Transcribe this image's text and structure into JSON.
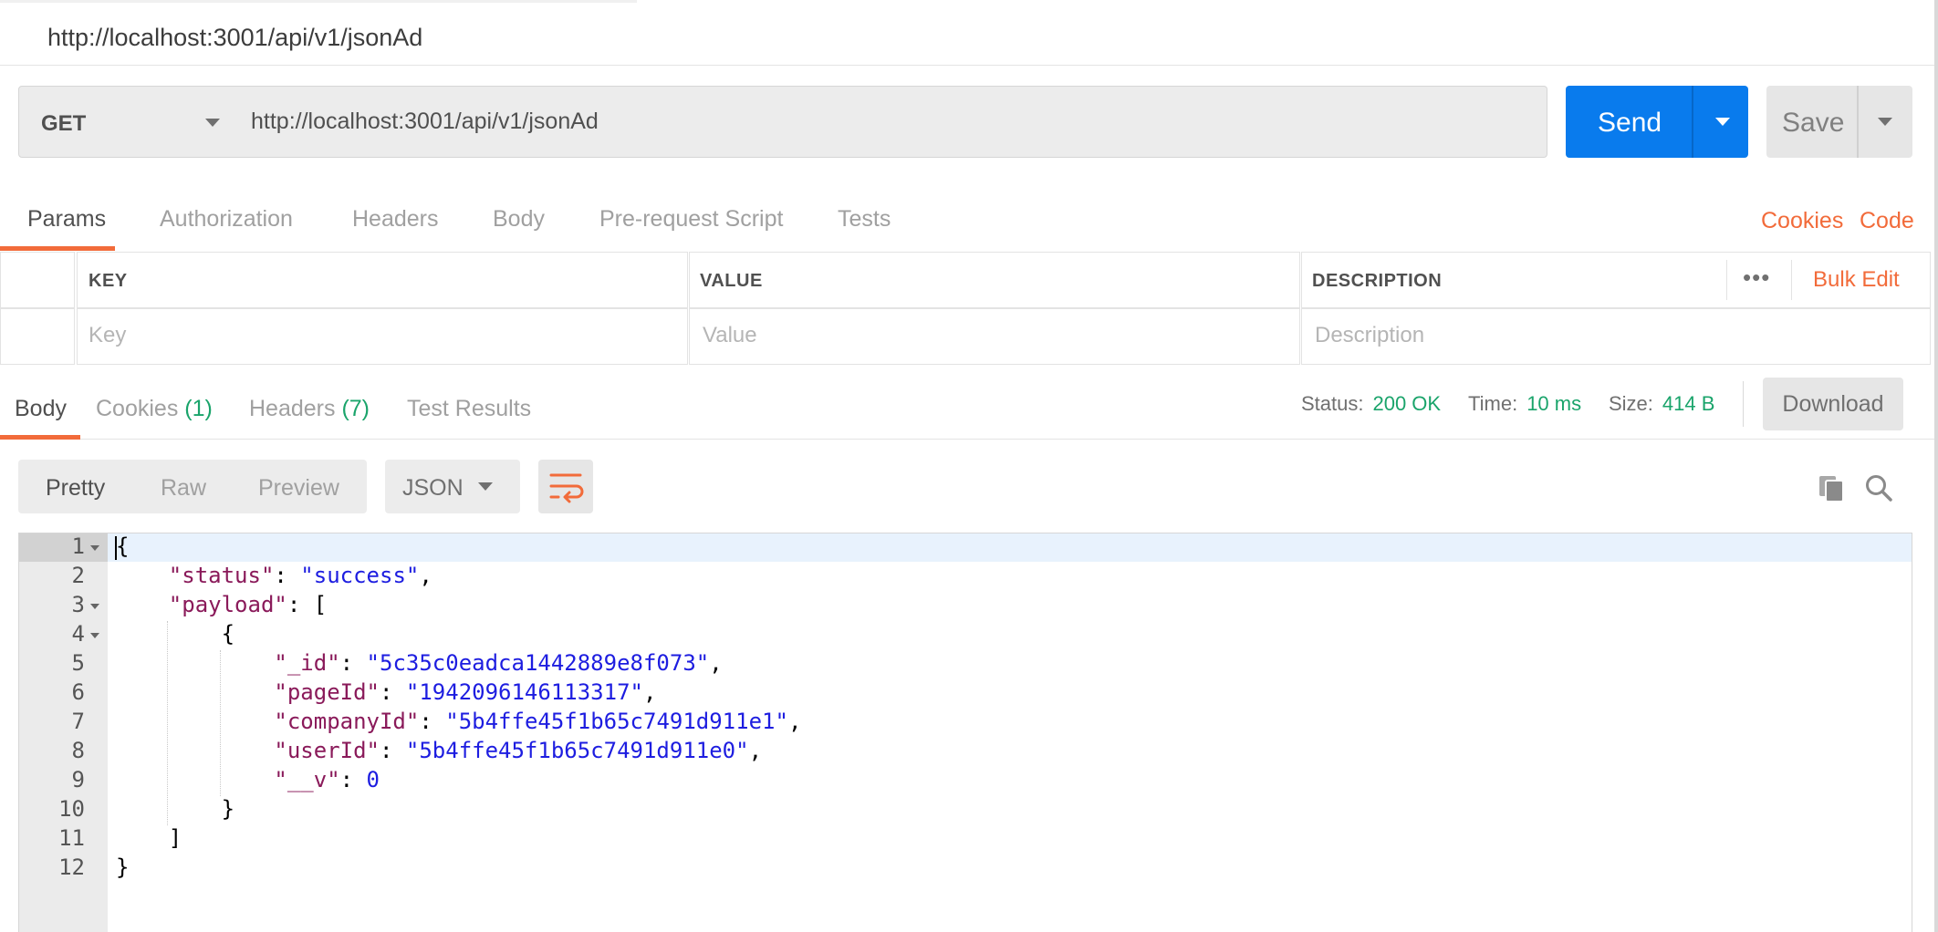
{
  "request": {
    "title": "http://localhost:3001/api/v1/jsonAd",
    "method": "GET",
    "url": "http://localhost:3001/api/v1/jsonAd",
    "send_label": "Send",
    "save_label": "Save"
  },
  "request_tabs": [
    "Params",
    "Authorization",
    "Headers",
    "Body",
    "Pre-request Script",
    "Tests"
  ],
  "request_links": {
    "cookies": "Cookies",
    "code": "Code"
  },
  "params": {
    "headers": {
      "key": "KEY",
      "value": "VALUE",
      "description": "DESCRIPTION"
    },
    "more": "•••",
    "bulk_edit": "Bulk Edit",
    "placeholders": {
      "key": "Key",
      "value": "Value",
      "description": "Description"
    }
  },
  "response_tabs": {
    "body": "Body",
    "cookies": "Cookies",
    "cookies_count": "(1)",
    "headers": "Headers",
    "headers_count": "(7)",
    "test_results": "Test Results"
  },
  "response_meta": {
    "status_label": "Status:",
    "status_value": "200 OK",
    "time_label": "Time:",
    "time_value": "10 ms",
    "size_label": "Size:",
    "size_value": "414 B",
    "download_label": "Download"
  },
  "view": {
    "modes": [
      "Pretty",
      "Raw",
      "Preview"
    ],
    "format": "JSON"
  },
  "colors": {
    "accent_orange": "#f26b3a",
    "send_blue": "#097bed",
    "status_green": "#1aa46b"
  },
  "editor": {
    "line_numbers": [
      "1",
      "2",
      "3",
      "4",
      "5",
      "6",
      "7",
      "8",
      "9",
      "10",
      "11",
      "12"
    ],
    "lines": {
      "l1": "{",
      "l2_key": "\"status\"",
      "l2_val": "\"success\"",
      "l3_key": "\"payload\"",
      "l3_open": "[",
      "l4": "{",
      "l5_key": "\"_id\"",
      "l5_val": "\"5c35c0eadca1442889e8f073\"",
      "l6_key": "\"pageId\"",
      "l6_val": "\"1942096146113317\"",
      "l7_key": "\"companyId\"",
      "l7_val": "\"5b4ffe45f1b65c7491d911e1\"",
      "l8_key": "\"userId\"",
      "l8_val": "\"5b4ffe45f1b65c7491d911e0\"",
      "l9_key": "\"__v\"",
      "l9_val": "0",
      "l10": "}",
      "l11": "]",
      "l12": "}"
    }
  }
}
